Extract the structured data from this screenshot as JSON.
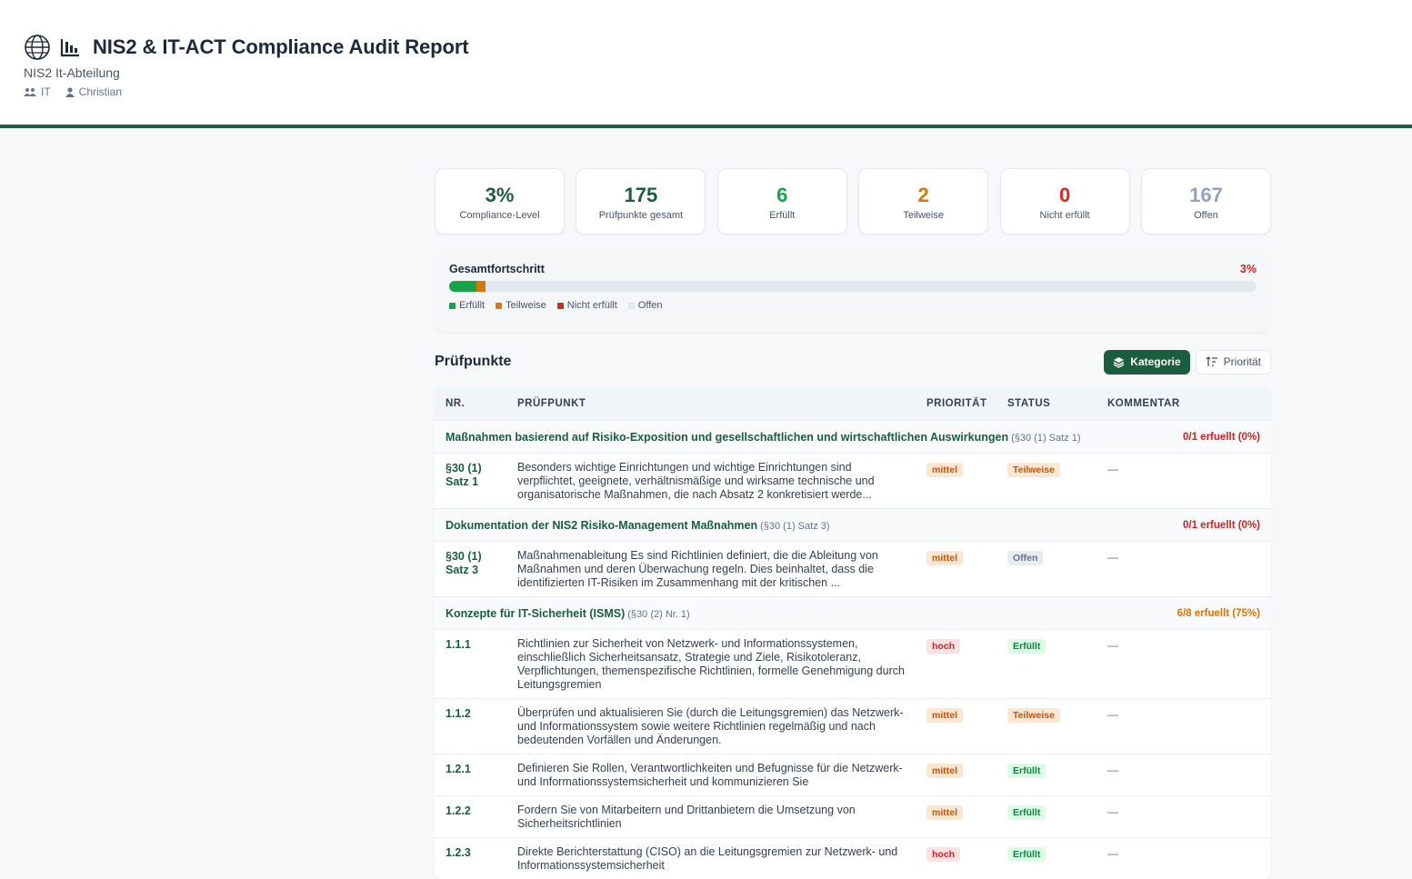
{
  "header": {
    "title": "NIS2 & IT-ACT Compliance Audit Report",
    "subtitle": "NIS2 It-Abteilung",
    "team": "IT",
    "user": "Christian"
  },
  "stats": [
    {
      "value": "3%",
      "label": "Compliance-Level",
      "color": "#1b5e3f"
    },
    {
      "value": "175",
      "label": "Prüfpunkte gesamt",
      "color": "#1b5e3f"
    },
    {
      "value": "6",
      "label": "Erfüllt",
      "color": "#16a34a"
    },
    {
      "value": "2",
      "label": "Teilweise",
      "color": "#d97706"
    },
    {
      "value": "0",
      "label": "Nicht erfüllt",
      "color": "#dc2626"
    },
    {
      "value": "167",
      "label": "Offen",
      "color": "#94a3b8"
    }
  ],
  "progress": {
    "title": "Gesamtfortschritt",
    "percent_label": "3%",
    "segments": [
      {
        "name": "Erfüllt",
        "fraction": 0.034,
        "color": "#16a34a"
      },
      {
        "name": "Teilweise",
        "fraction": 0.011,
        "color": "#d97706"
      },
      {
        "name": "Nicht erfüllt",
        "fraction": 0.0,
        "color": "#dc2626"
      },
      {
        "name": "Offen",
        "fraction": 0.955,
        "color": "#e2e8f0"
      }
    ],
    "legend": [
      "Erfüllt",
      "Teilweise",
      "Nicht erfüllt",
      "Offen"
    ]
  },
  "section": {
    "title": "Prüfpunkte",
    "btn_category": "Kategorie",
    "btn_priority": "Priorität"
  },
  "table": {
    "headers": {
      "nr": "NR.",
      "pp": "PRÜFPUNKT",
      "pr": "PRIORITÄT",
      "st": "STATUS",
      "ko": "KOMMENTAR"
    },
    "categories": [
      {
        "name": "Maßnahmen basierend auf Risiko-Exposition und gesellschaftlichen und wirtschaftlichen Auswirkungen",
        "ref": "(§30 (1) Satz 1)",
        "status": "0/1 erfuellt (0%)",
        "status_color": "#c62828",
        "rows": [
          {
            "nr": "§30 (1) Satz 1",
            "text": "Besonders wichtige Einrichtungen und wichtige Einrichtungen sind verpflichtet, geeignete, verhältnismäßige und wirksame technische und organisatorische Maßnahmen, die nach Absatz 2 konkretisiert werde...",
            "priority": "mittel",
            "status": "Teilweise",
            "comment": "—"
          }
        ]
      },
      {
        "name": "Dokumentation der NIS2 Risiko-Management Maßnahmen",
        "ref": "(§30 (1) Satz 3)",
        "status": "0/1 erfuellt (0%)",
        "status_color": "#c62828",
        "rows": [
          {
            "nr": "§30 (1) Satz 3",
            "text": "Maßnahmenableitung Es sind Richtlinien definiert, die die Ableitung von Maßnahmen und deren Überwachung regeln. Dies beinhaltet, dass die identifizierten IT-Risiken im Zusammenhang mit der kritischen ...",
            "priority": "mittel",
            "status": "Offen",
            "comment": "—"
          }
        ]
      },
      {
        "name": "Konzepte für IT-Sicherheit (ISMS)",
        "ref": "(§30 (2) Nr. 1)",
        "status": "6/8 erfuellt (75%)",
        "status_color": "#d97706",
        "rows": [
          {
            "nr": "1.1.1",
            "text": "Richtlinien zur Sicherheit von Netzwerk- und Informationssystemen, einschließlich Sicherheitsansatz, Strategie und Ziele, Risikotoleranz, Verpflichtungen, themenspezifische Richtlinien, formelle Genehmigung durch Leitungsgremien",
            "priority": "hoch",
            "status": "Erfüllt",
            "comment": "—"
          },
          {
            "nr": "1.1.2",
            "text": "Überprüfen und aktualisieren Sie (durch die Leitungsgremien) das Netzwerk- und Informationssystem sowie weitere Richtlinien regelmäßig und nach bedeutenden Vorfällen und Änderungen.",
            "priority": "mittel",
            "status": "Teilweise",
            "comment": "—"
          },
          {
            "nr": "1.2.1",
            "text": "Definieren Sie Rollen, Verantwortlichkeiten und Befugnisse für die Netzwerk- und Informationssystemsicherheit und kommunizieren Sie",
            "priority": "mittel",
            "status": "Erfüllt",
            "comment": "—"
          },
          {
            "nr": "1.2.2",
            "text": "Fordern Sie von Mitarbeitern und Drittanbietern die Umsetzung von Sicherheitsrichtlinien",
            "priority": "mittel",
            "status": "Erfüllt",
            "comment": "—"
          },
          {
            "nr": "1.2.3",
            "text": "Direkte Berichterstattung (CISO) an die Leitungsgremien zur Netzwerk- und Informationssystemsicherheit",
            "priority": "hoch",
            "status": "Erfüllt",
            "comment": "—"
          }
        ]
      }
    ]
  },
  "colors": {
    "accent": "#1b5e3f",
    "prio_mittel_bg": "#fde7d3",
    "prio_mittel_fg": "#c2560c",
    "prio_hoch_bg": "#fde2e2",
    "prio_hoch_fg": "#c62828",
    "st_teil_bg": "#fde7d3",
    "st_teil_fg": "#c2560c",
    "st_offen_bg": "#e8ebef",
    "st_offen_fg": "#64748b",
    "st_erf_bg": "#dcfce7",
    "st_erf_fg": "#15803d"
  }
}
